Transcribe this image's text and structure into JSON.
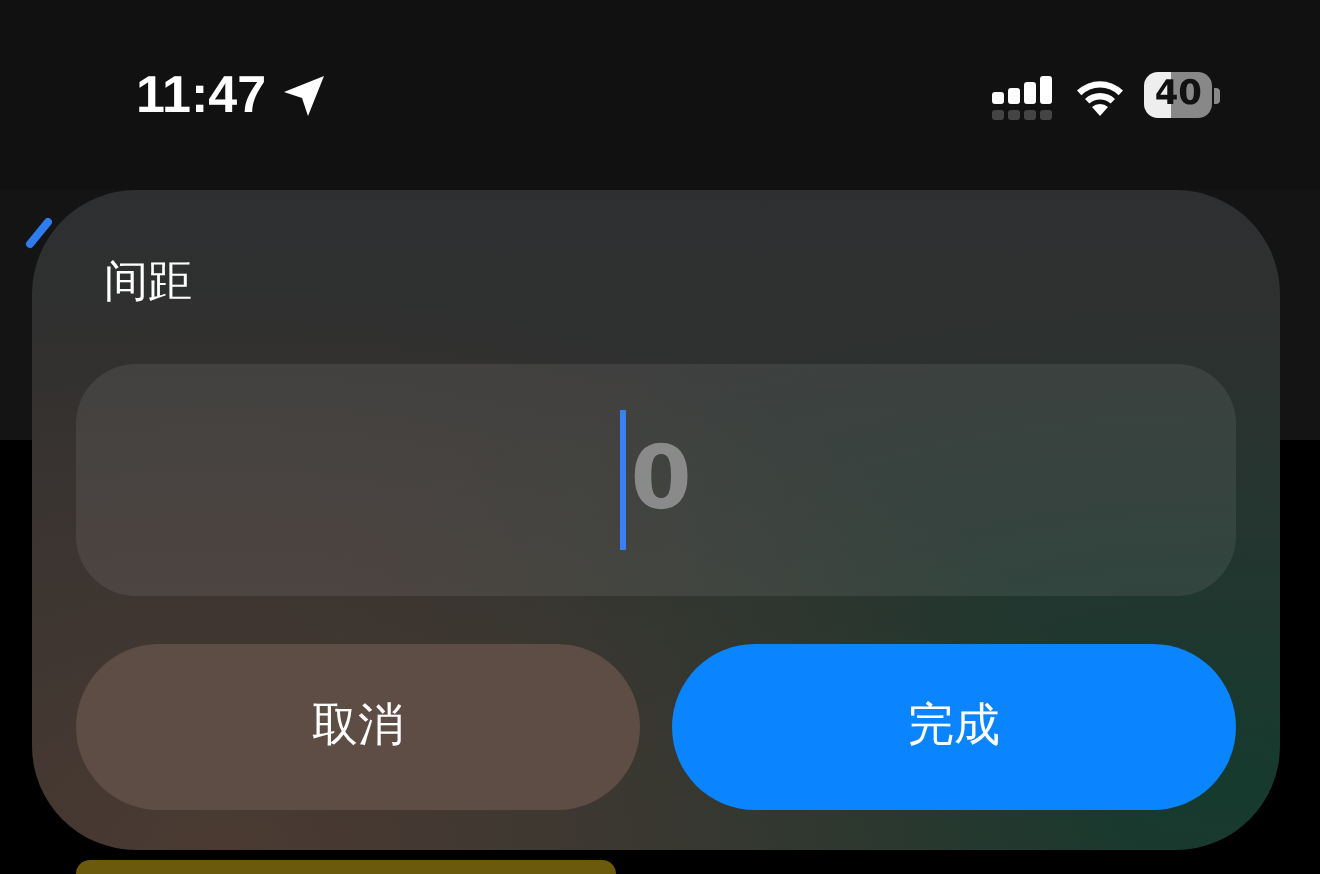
{
  "status_bar": {
    "time": "11:47",
    "battery": "40",
    "location_active": true
  },
  "dialog": {
    "title": "间距",
    "field": {
      "placeholder": "0",
      "focused": true
    },
    "buttons": [
      {
        "label": "取消",
        "kind": "cancel"
      },
      {
        "label": "完成",
        "kind": "primary"
      }
    ]
  }
}
